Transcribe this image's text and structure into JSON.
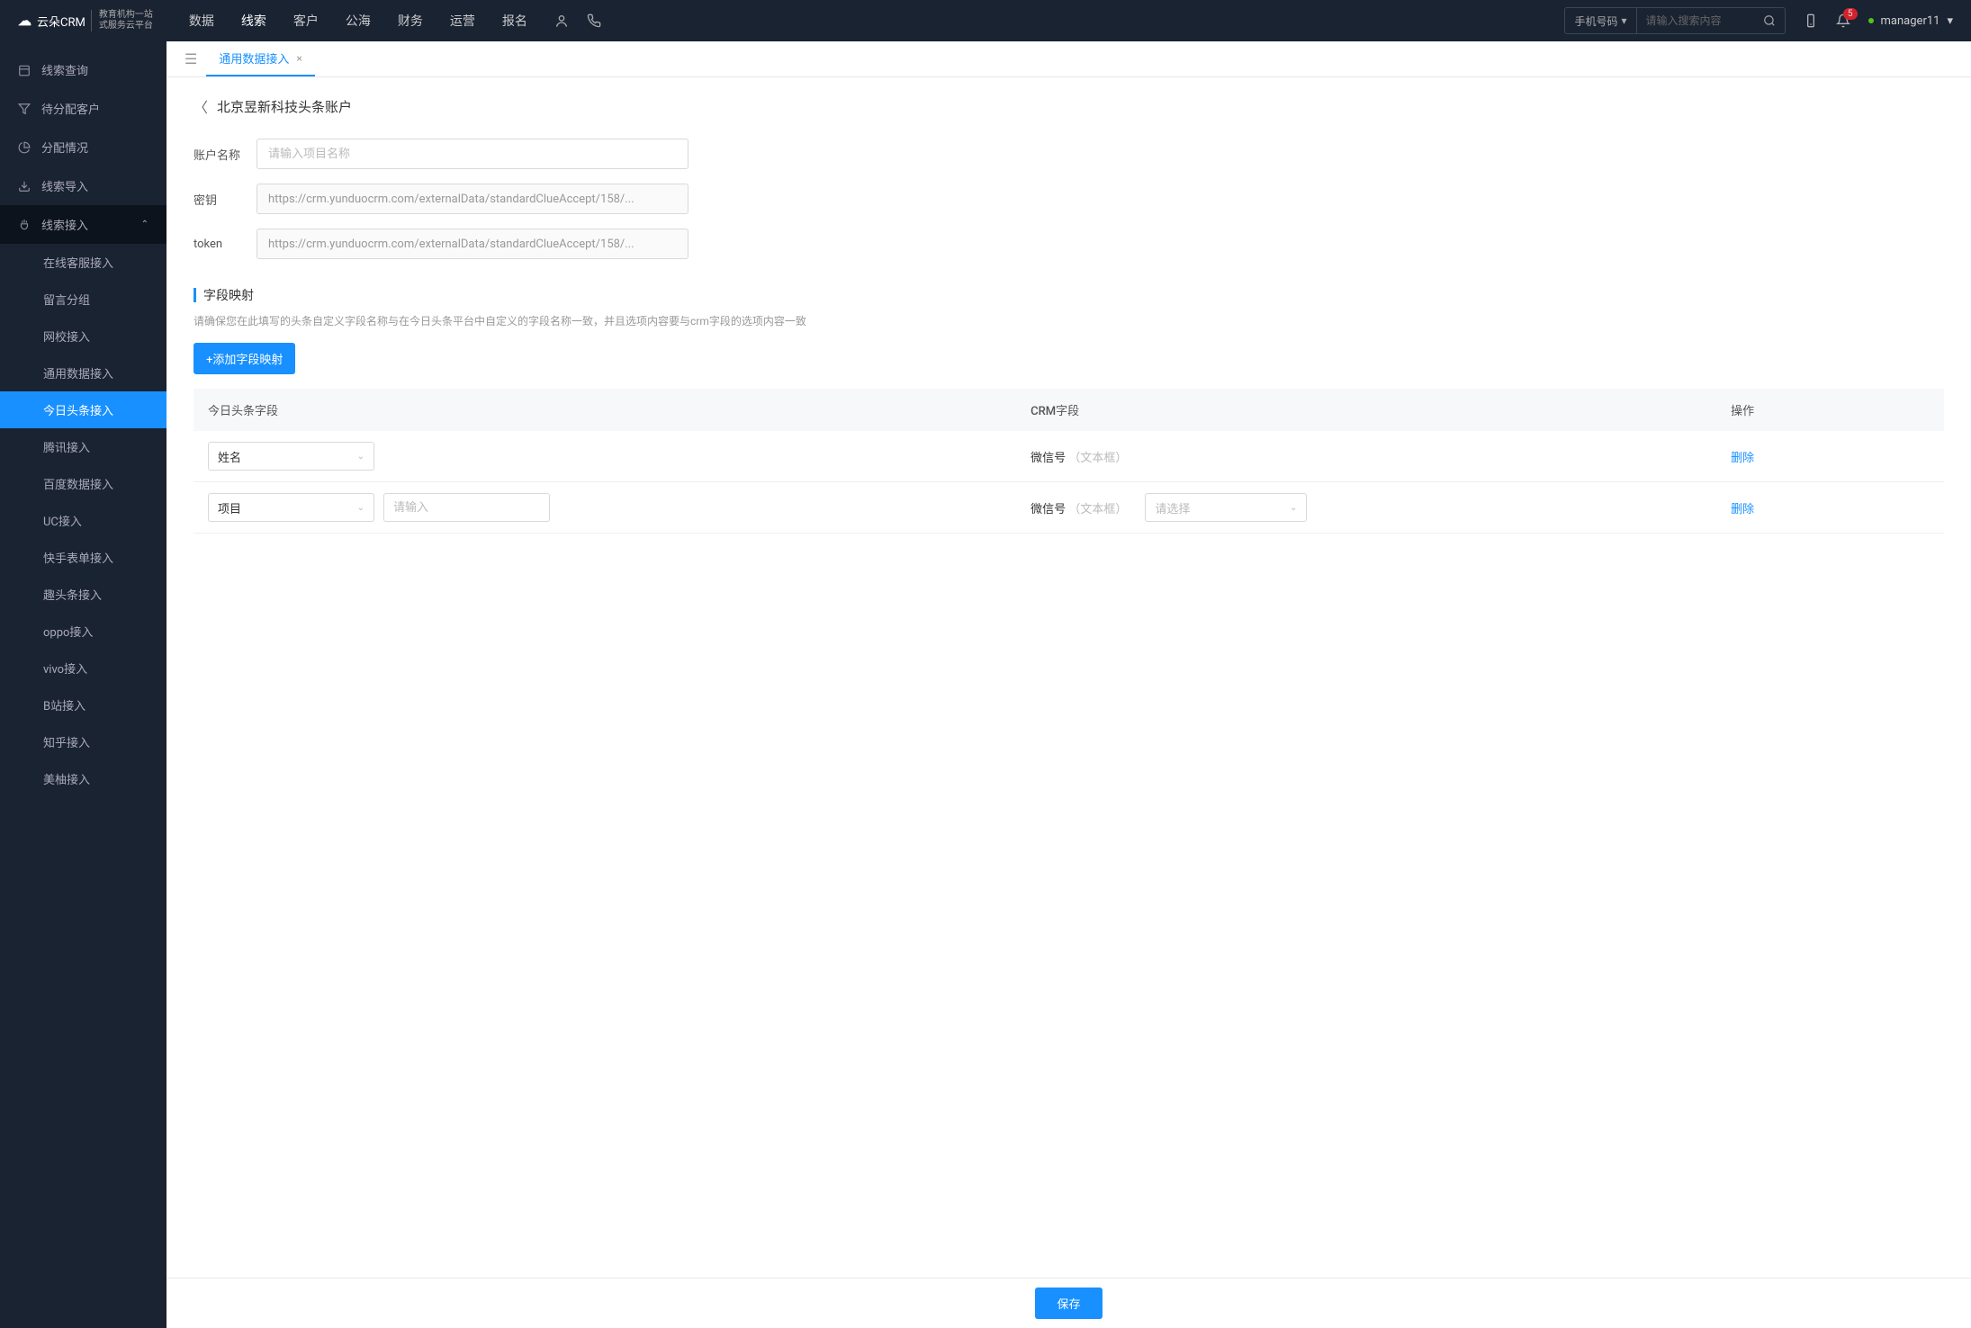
{
  "header": {
    "logo": "云朵CRM",
    "logo_sub1": "教育机构一站",
    "logo_sub2": "式服务云平台",
    "nav": [
      "数据",
      "线索",
      "客户",
      "公海",
      "财务",
      "运营",
      "报名"
    ],
    "nav_active": 1,
    "search_type": "手机号码",
    "search_placeholder": "请输入搜索内容",
    "badge": "5",
    "user": "manager11"
  },
  "sidebar": {
    "items": [
      {
        "icon": "calendar",
        "label": "线索查询"
      },
      {
        "icon": "filter",
        "label": "待分配客户"
      },
      {
        "icon": "pie",
        "label": "分配情况"
      },
      {
        "icon": "upload",
        "label": "线索导入"
      },
      {
        "icon": "plug",
        "label": "线索接入",
        "expandable": true,
        "expanded": true
      }
    ],
    "subs": [
      "在线客服接入",
      "留言分组",
      "网校接入",
      "通用数据接入",
      "今日头条接入",
      "腾讯接入",
      "百度数据接入",
      "UC接入",
      "快手表单接入",
      "趣头条接入",
      "oppo接入",
      "vivo接入",
      "B站接入",
      "知乎接入",
      "美柚接入"
    ],
    "sub_active": 4
  },
  "tabs": {
    "items": [
      {
        "label": "通用数据接入"
      }
    ]
  },
  "page": {
    "title": "北京昱新科技头条账户",
    "form": {
      "account_label": "账户名称",
      "account_placeholder": "请输入项目名称",
      "secret_label": "密钥",
      "secret_value": "https://crm.yunduocrm.com/externalData/standardClueAccept/158/...",
      "token_label": "token",
      "token_value": "https://crm.yunduocrm.com/externalData/standardClueAccept/158/..."
    },
    "mapping": {
      "title": "字段映射",
      "desc": "请确保您在此填写的头条自定义字段名称与在今日头条平台中自定义的字段名称一致，并且选项内容要与crm字段的选项内容一致",
      "add_btn": "+添加字段映射",
      "cols": [
        "今日头条字段",
        "CRM字段",
        "操作"
      ],
      "rows": [
        {
          "tt_field": "姓名",
          "crm_label": "微信号",
          "crm_hint": "（文本框）",
          "action": "删除"
        },
        {
          "tt_field": "项目",
          "input_placeholder": "请输入",
          "crm_label": "微信号",
          "crm_hint": "（文本框）",
          "select_placeholder": "请选择",
          "action": "删除"
        }
      ]
    },
    "save": "保存"
  }
}
